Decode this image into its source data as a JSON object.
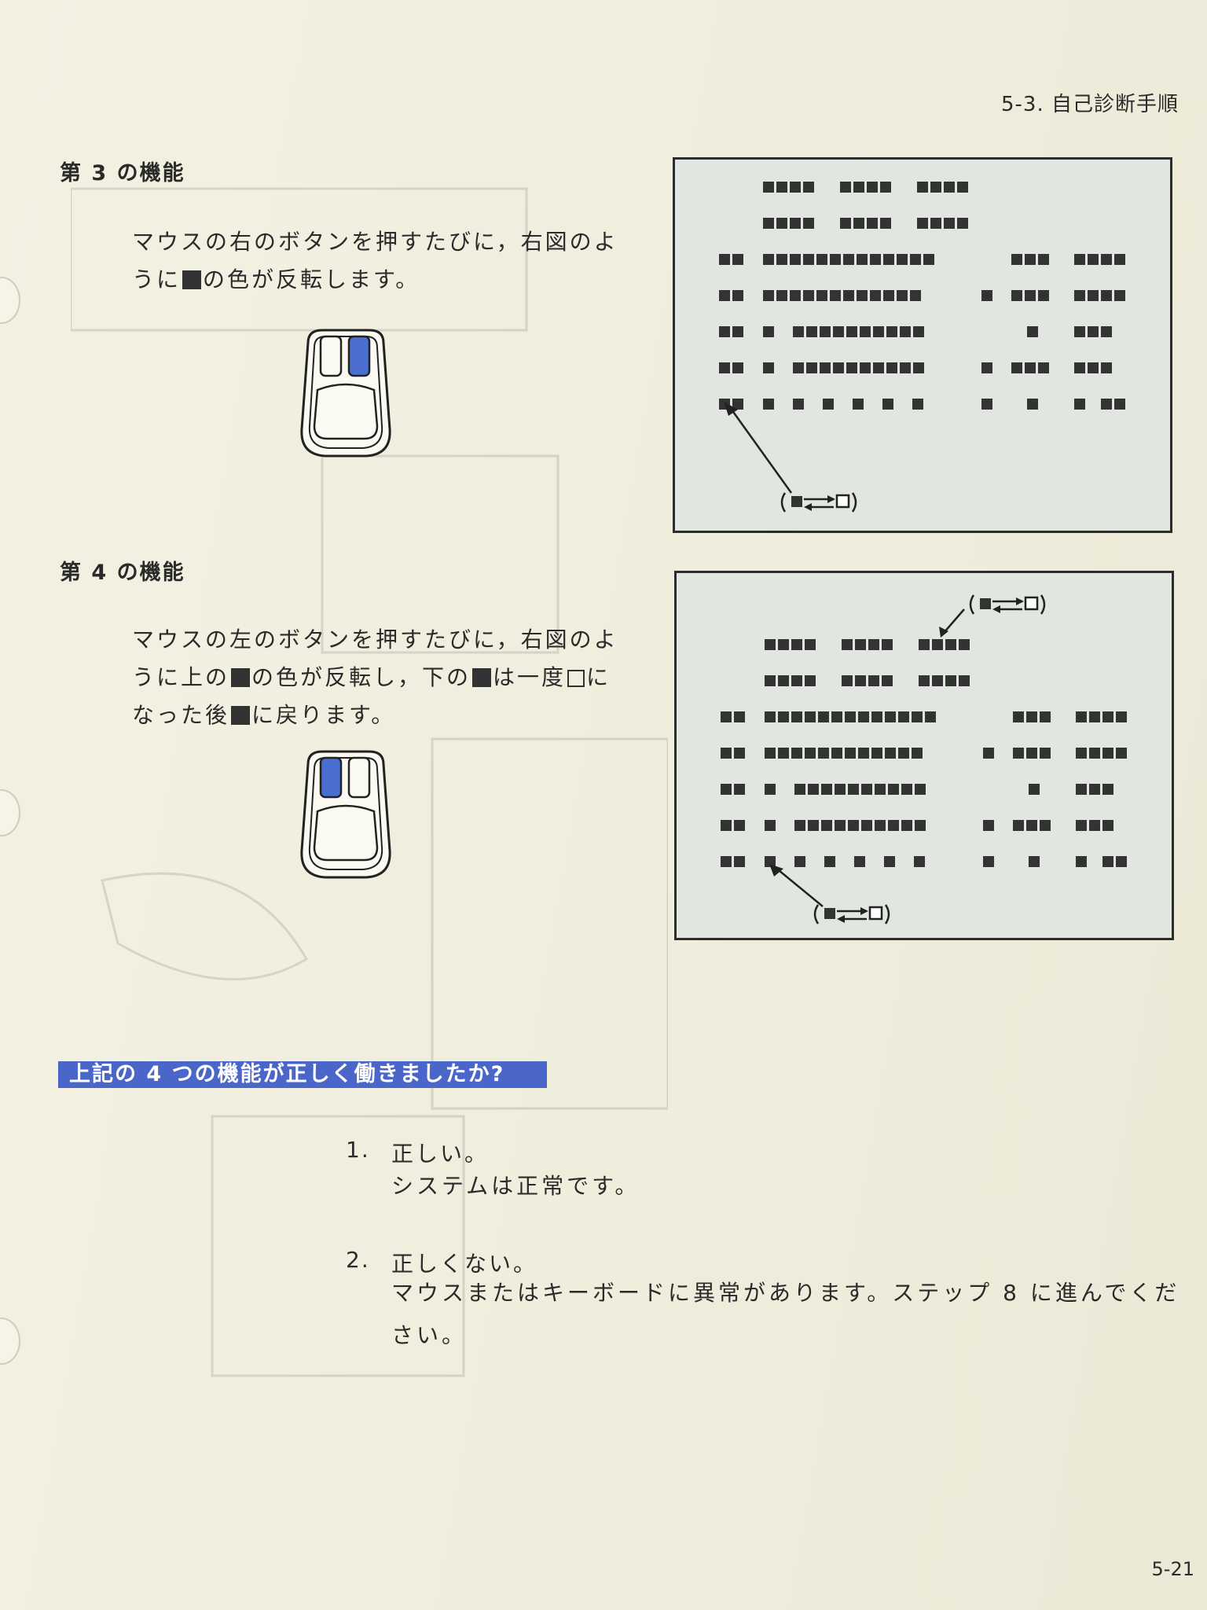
{
  "header": {
    "section": "5-3. 自己診断手順"
  },
  "function3": {
    "title": "第 3 の機能",
    "line1": "マウスの右のボタンを押すたびに，右図のよ",
    "line2_a": "うに",
    "line2_b": "の色が反転します。"
  },
  "function4": {
    "title": "第 4 の機能",
    "line1": "マウスの左のボタンを押すたびに，右図のよ",
    "line2_a": "うに上の",
    "line2_b": "の色が反転し，下の",
    "line2_c": "は一度",
    "line2_d": "に",
    "line3_a": "なった後",
    "line3_b": "に戻ります。"
  },
  "question": "上記の 4 つの機能が正しく働きましたか?",
  "answers": [
    {
      "number": "1.",
      "label": "正しい。",
      "description": "システムは正常です。"
    },
    {
      "number": "2.",
      "label": "正しくない。",
      "description": "マウスまたはキーボードに異常があります。ステップ 8 に進んでください。"
    }
  ],
  "page_number": "5-21",
  "colors": {
    "highlight": "#4a66c8",
    "mouse_button_pressed": "#4a6fd0",
    "screen_bg": "#e2e6e0"
  },
  "icons": [
    "mouse-right-button-icon",
    "mouse-left-button-icon",
    "toggle-indicator-icon"
  ]
}
